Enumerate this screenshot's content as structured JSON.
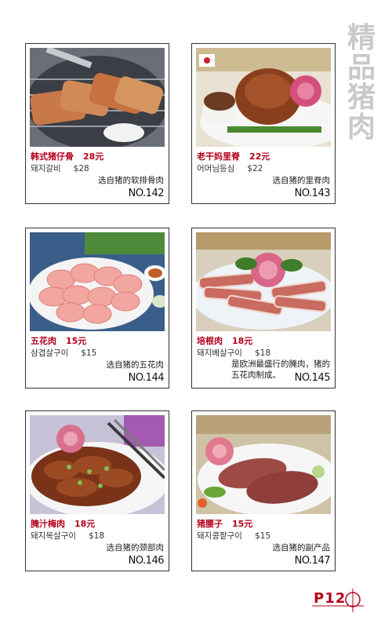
{
  "side_title": [
    "精",
    "品",
    "猪",
    "肉"
  ],
  "items": [
    {
      "name": "韩式猪仔骨",
      "price": "28元",
      "korean": "돼지갈비",
      "usd": "$28",
      "desc": "选自猪的软排骨肉",
      "no": "NO.142"
    },
    {
      "name": "老干妈里脊",
      "price": "22元",
      "korean": "어머님등심",
      "usd": "$22",
      "desc": "选自猪的里脊肉",
      "no": "NO.143"
    },
    {
      "name": "五花肉",
      "price": "15元",
      "korean": "삼겹살구이",
      "usd": "$15",
      "desc": "选自猪的五花肉",
      "no": "NO.144"
    },
    {
      "name": "培根肉",
      "price": "18元",
      "korean": "돼지베살구이",
      "usd": "$18",
      "desc": "是欧洲最盛行的腌肉，猪的五花肉制成。",
      "no": "NO.145"
    },
    {
      "name": "腌汁梅肉",
      "price": "18元",
      "korean": "돼지목살구이",
      "usd": "$18",
      "desc": "选自猪的颈部肉",
      "no": "NO.146"
    },
    {
      "name": "猪腰子",
      "price": "15元",
      "korean": "돼지콩팥구이",
      "usd": "$15",
      "desc": "选自猪的副产品",
      "no": "NO.147"
    }
  ],
  "page_number": "P12",
  "colors": {
    "accent": "#b3001b",
    "title_grey": "#c9c9c9"
  }
}
